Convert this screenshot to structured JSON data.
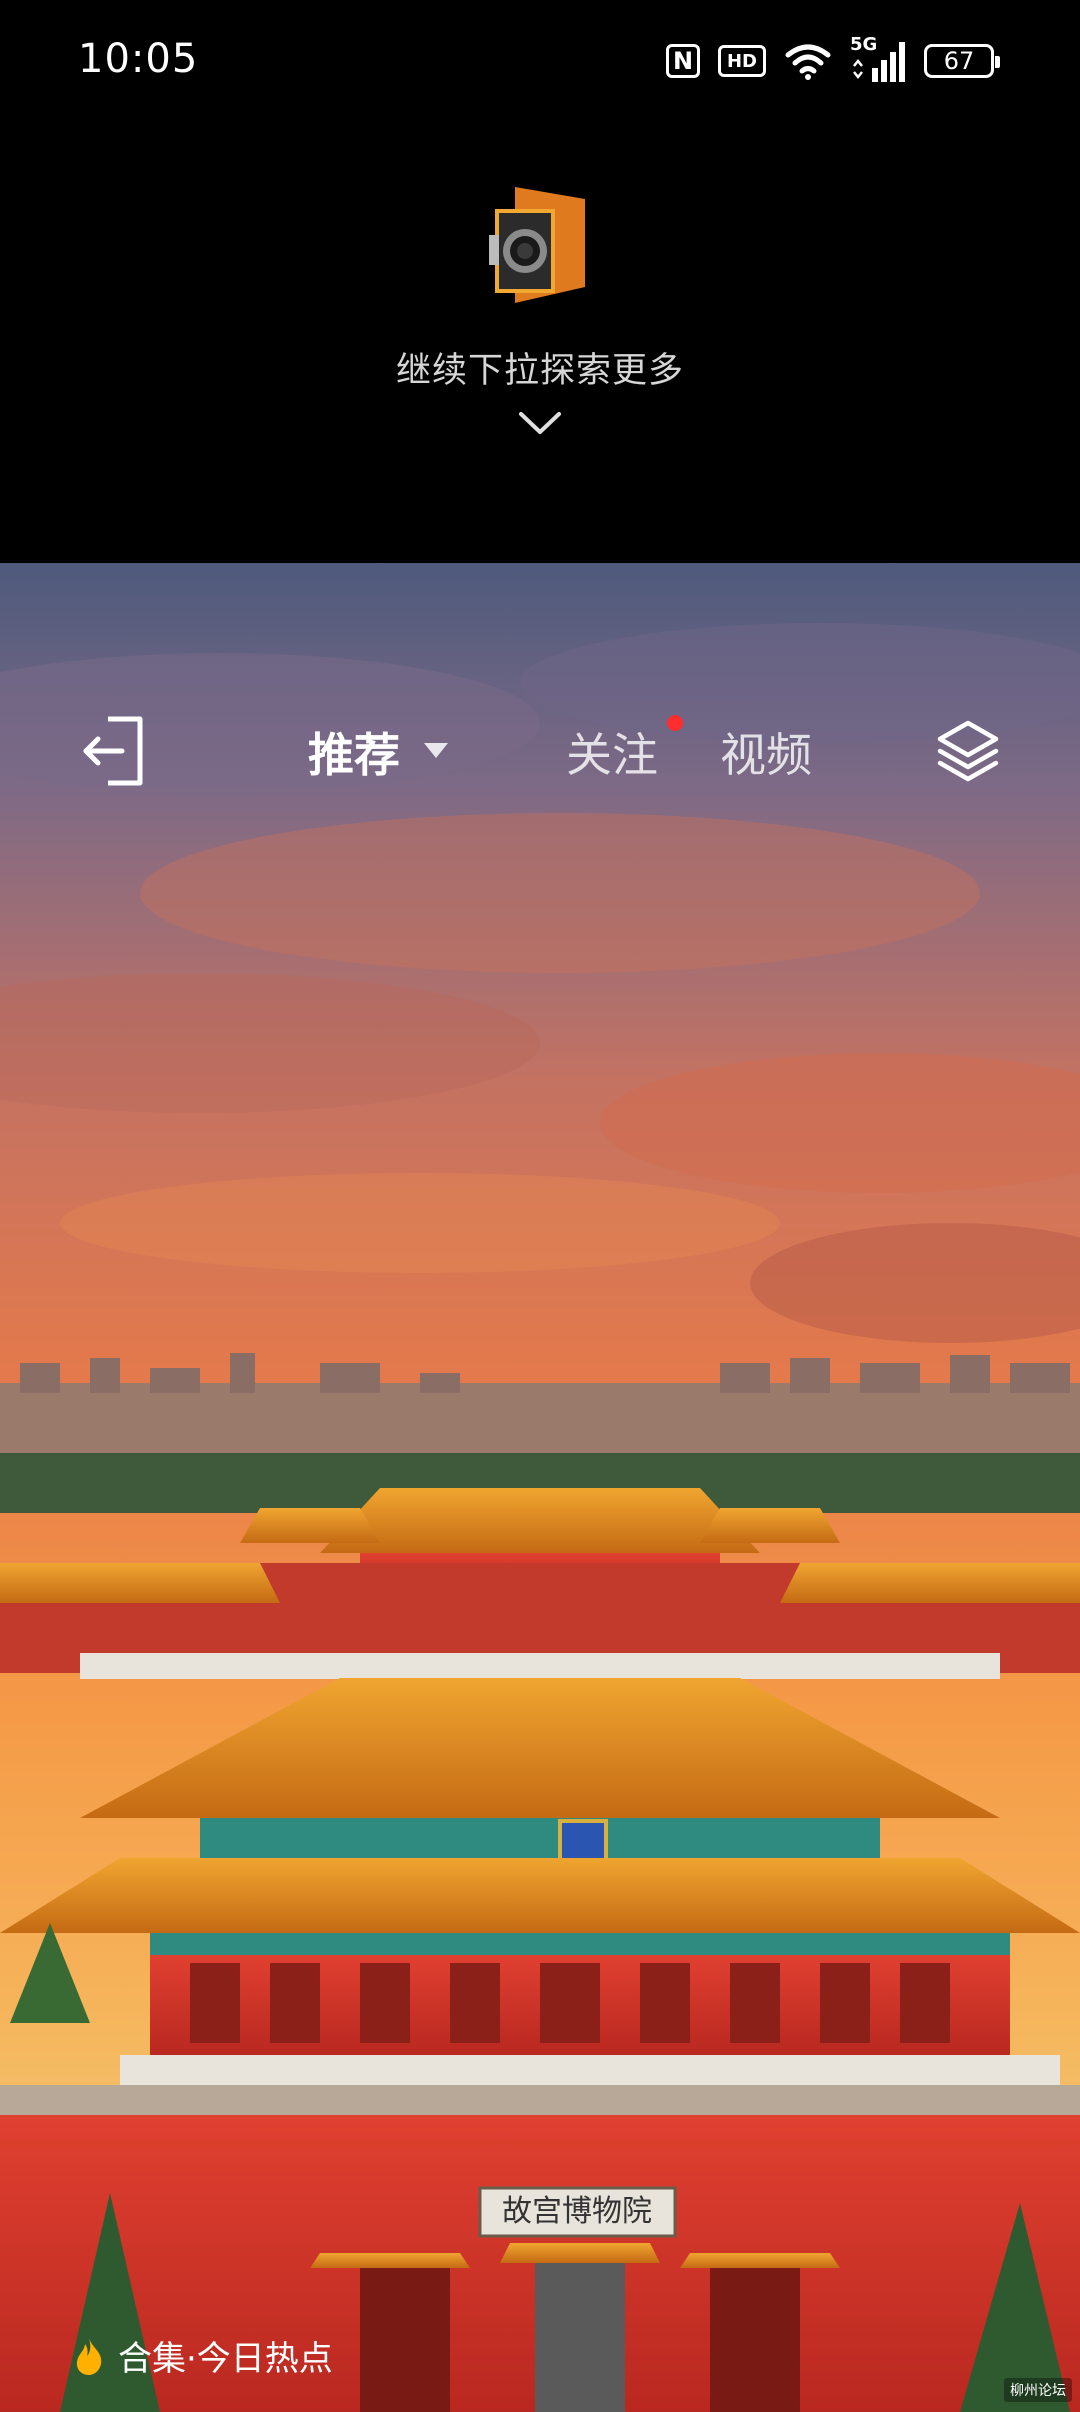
{
  "status_bar": {
    "time": "10:05",
    "nfc_label": "N",
    "hd_label": "HD",
    "network_label": "5G",
    "battery_level": "67"
  },
  "pull_hint": {
    "text": "继续下拉探索更多",
    "icon": "chevron-down-icon"
  },
  "nav": {
    "tabs": [
      {
        "label": "推荐",
        "active": true
      },
      {
        "label": "关注",
        "has_dot": true
      },
      {
        "label": "视频"
      }
    ],
    "left_icon": "exit-icon",
    "right_icon": "layers-icon"
  },
  "collection": {
    "label": "合集·今日热点",
    "icon": "flame-icon"
  },
  "hero": {
    "plaque_text": "故宫博物院",
    "sky_top": "#5b5a78",
    "sky_mid": "#e8804a",
    "roof_color": "#d98a1c",
    "wall_color": "#d3352a"
  },
  "watermark": "柳州论坛"
}
